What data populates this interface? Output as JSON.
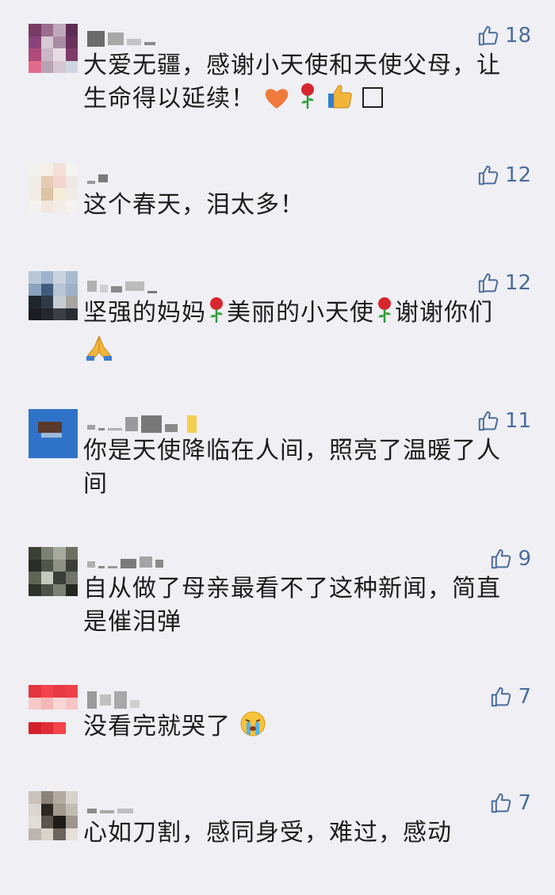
{
  "colors": {
    "like": "#4a6d9a",
    "background": "#efeff4",
    "text": "#1d1d1d"
  },
  "comments": [
    {
      "likes": "18",
      "text": "大爱无疆，感谢小天使和天使父母，让生命得以延续！",
      "emojis": [
        "heart-emoji",
        "rose-emoji",
        "thumbs-up-emoji",
        "box-glyph"
      ]
    },
    {
      "likes": "12",
      "text": "这个春天，泪太多！",
      "emojis": []
    },
    {
      "likes": "12",
      "text_parts": [
        "坚强的妈妈",
        "美丽的小天使",
        "谢谢你们"
      ],
      "emojis": [
        "rose-emoji",
        "rose-emoji",
        "pray-emoji"
      ]
    },
    {
      "likes": "11",
      "text": "你是天使降临在人间，照亮了温暖了人间",
      "emojis": []
    },
    {
      "likes": "9",
      "text": "自从做了母亲最看不了这种新闻，简直是催泪弹",
      "emojis": []
    },
    {
      "likes": "7",
      "text": "没看完就哭了",
      "emojis": [
        "crying-emoji"
      ]
    },
    {
      "likes": "7",
      "text": "心如刀割，感同身受，难过，感动",
      "emojis": []
    }
  ]
}
